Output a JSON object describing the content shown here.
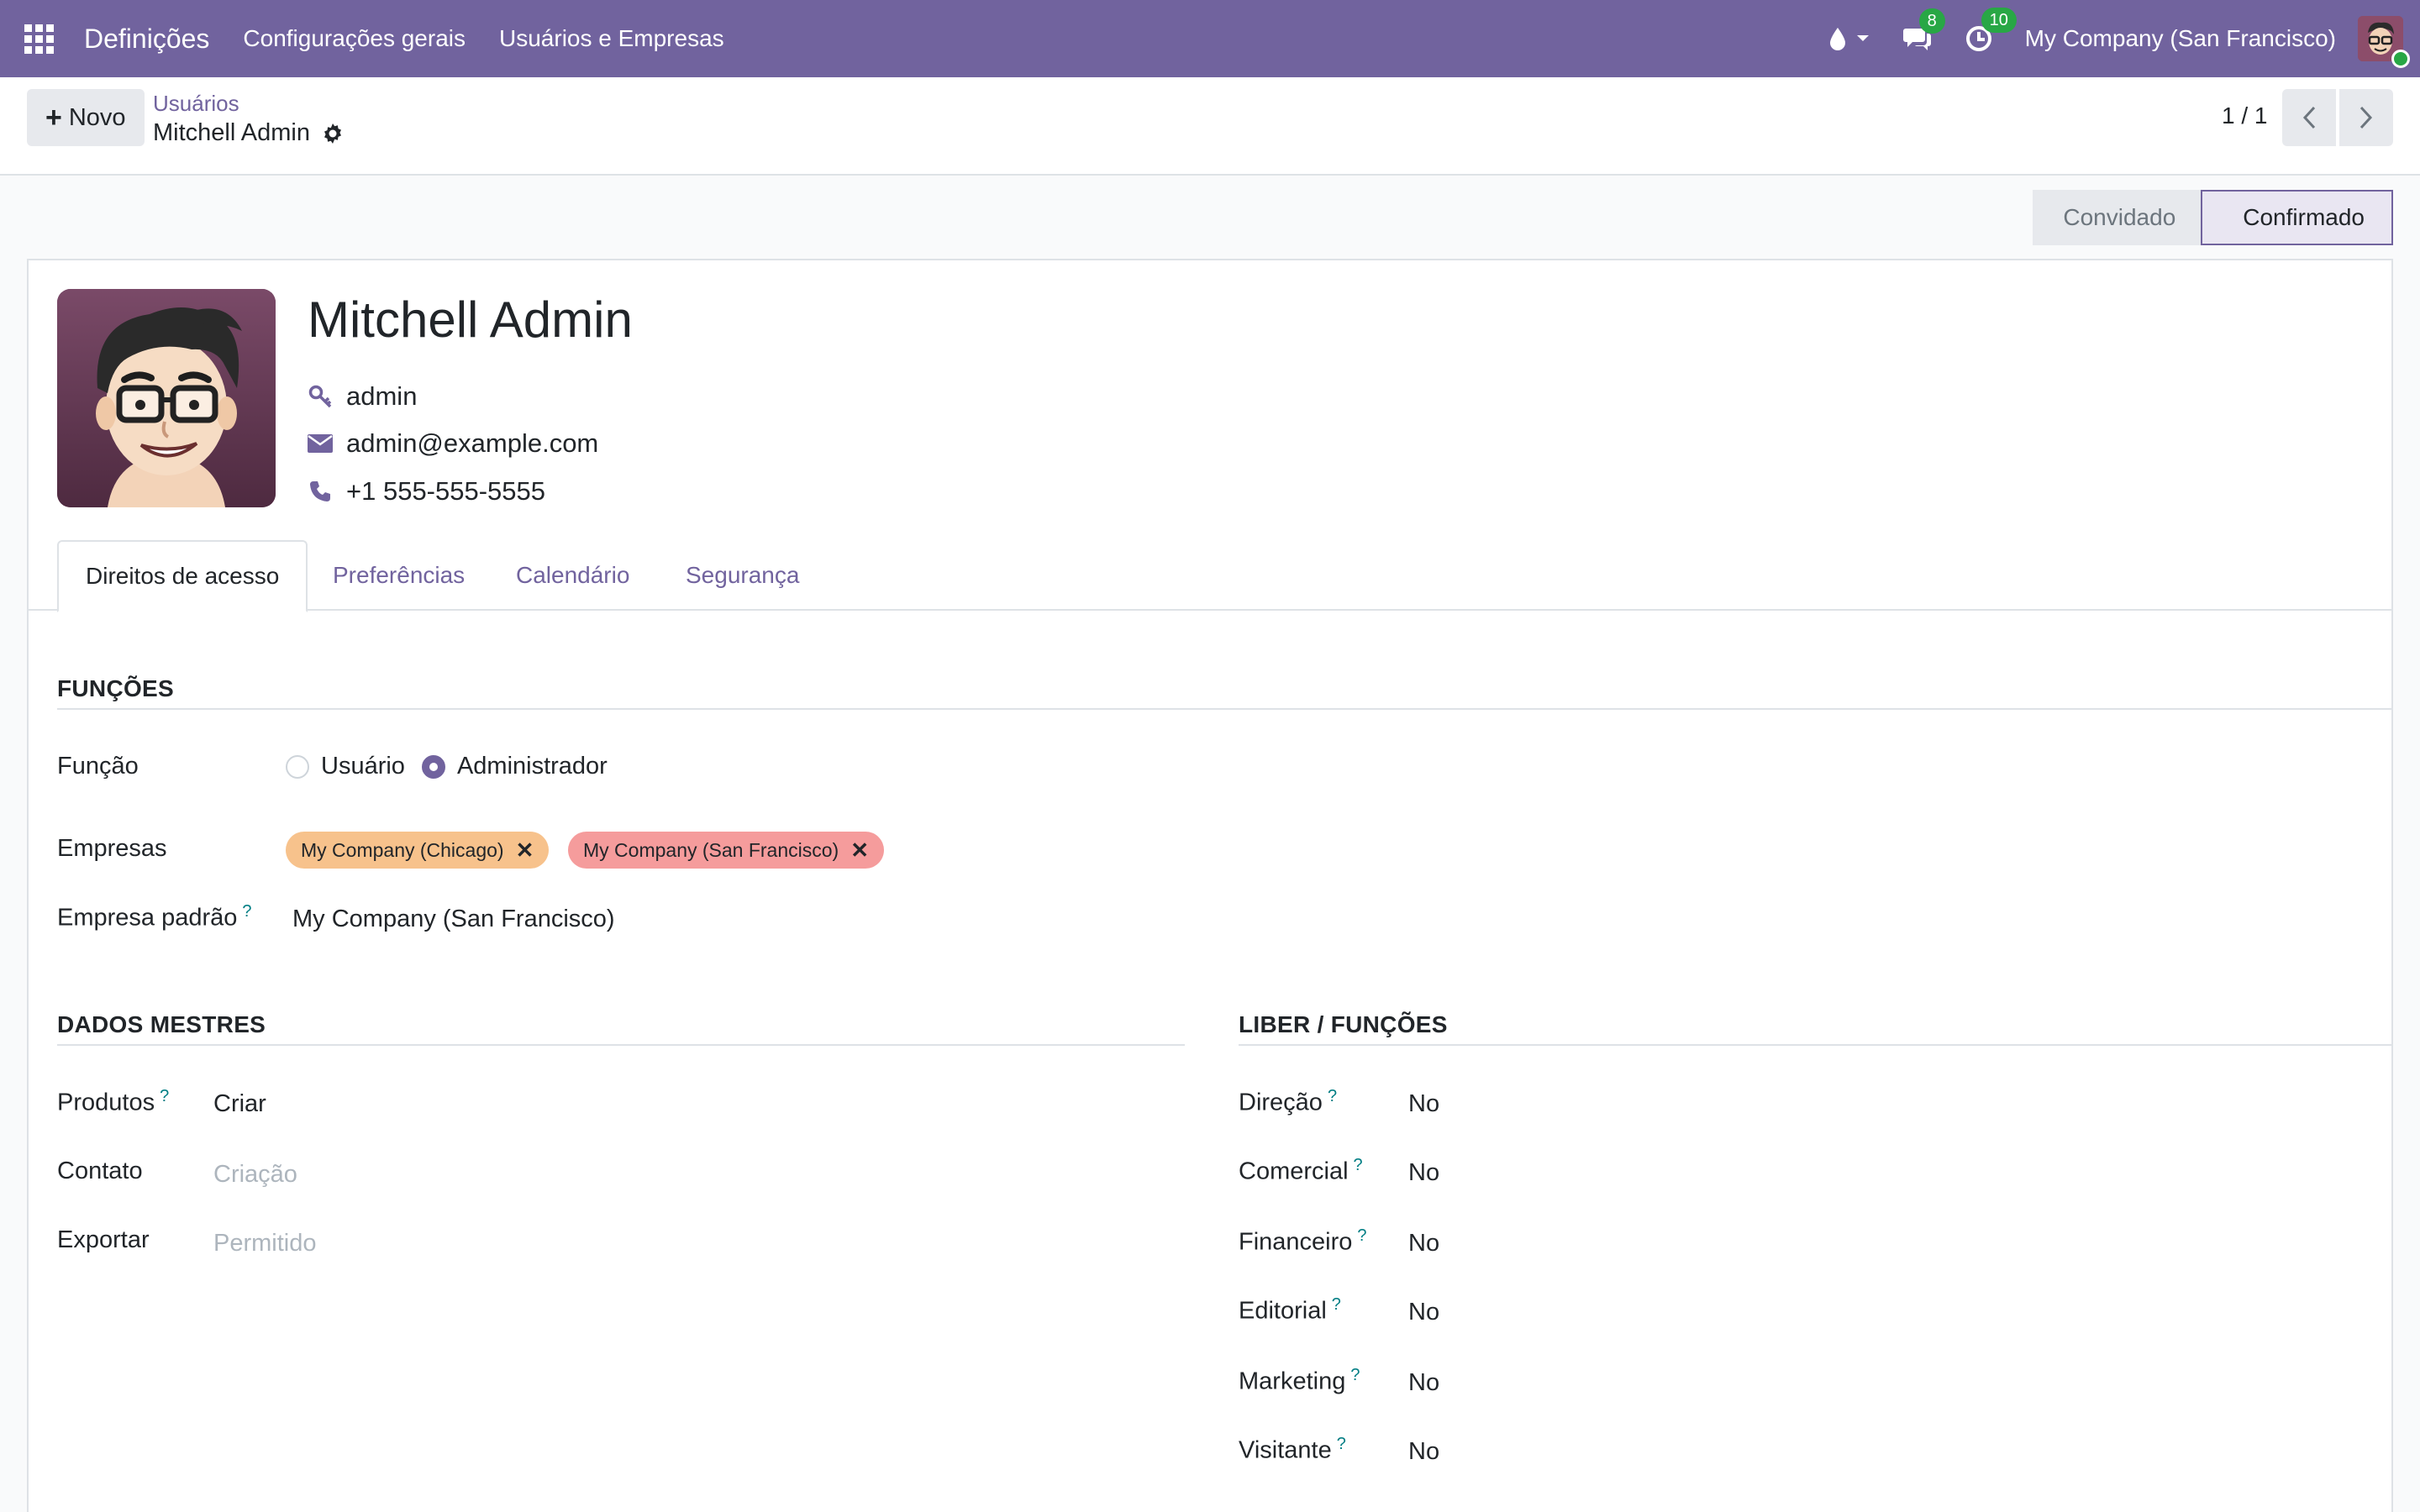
{
  "navbar": {
    "app_name": "Definições",
    "menu": [
      "Configurações gerais",
      "Usuários e Empresas"
    ],
    "messages_count": "8",
    "activities_count": "10",
    "company": "My Company (San Francisco)"
  },
  "control_panel": {
    "new_label": "Novo",
    "breadcrumb_parent": "Usuários",
    "breadcrumb_current": "Mitchell Admin",
    "pager": "1 / 1"
  },
  "status": {
    "stages": [
      "Convidado",
      "Confirmado"
    ],
    "current": "Confirmado"
  },
  "user": {
    "name": "Mitchell Admin",
    "login": "admin",
    "email": "admin@example.com",
    "phone": "+1 555-555-5555"
  },
  "tabs": [
    "Direitos de acesso",
    "Preferências",
    "Calendário",
    "Segurança"
  ],
  "functions_section": {
    "title": "FUNÇÕES",
    "role_label": "Função",
    "role_options": [
      "Usuário",
      "Administrador"
    ],
    "role_selected": "Administrador",
    "companies_label": "Empresas",
    "companies": [
      "My Company (Chicago)",
      "My Company (San Francisco)"
    ],
    "default_company_label": "Empresa padrão",
    "default_company": "My Company (San Francisco)"
  },
  "master_data": {
    "title": "DADOS MESTRES",
    "fields": [
      {
        "label": "Produtos",
        "value": "Criar",
        "help": "?"
      },
      {
        "label": "Contato",
        "value": "Criação",
        "placeholder": true
      },
      {
        "label": "Exportar",
        "value": "Permitido",
        "placeholder": true
      }
    ]
  },
  "liber_functions": {
    "title": "LIBER / FUNÇÕES",
    "fields": [
      {
        "label": "Direção",
        "value": "No"
      },
      {
        "label": "Comercial",
        "value": "No"
      },
      {
        "label": "Financeiro",
        "value": "No"
      },
      {
        "label": "Editorial",
        "value": "No"
      },
      {
        "label": "Marketing",
        "value": "No"
      },
      {
        "label": "Visitante",
        "value": "No"
      }
    ]
  },
  "help_mark": "?",
  "colors": {
    "navbar": "#71639e",
    "accent": "#71639e",
    "badge": "#28a745",
    "tag_chicago": "#f7c28c",
    "tag_sf": "#f59c9c",
    "help": "#017e84"
  }
}
